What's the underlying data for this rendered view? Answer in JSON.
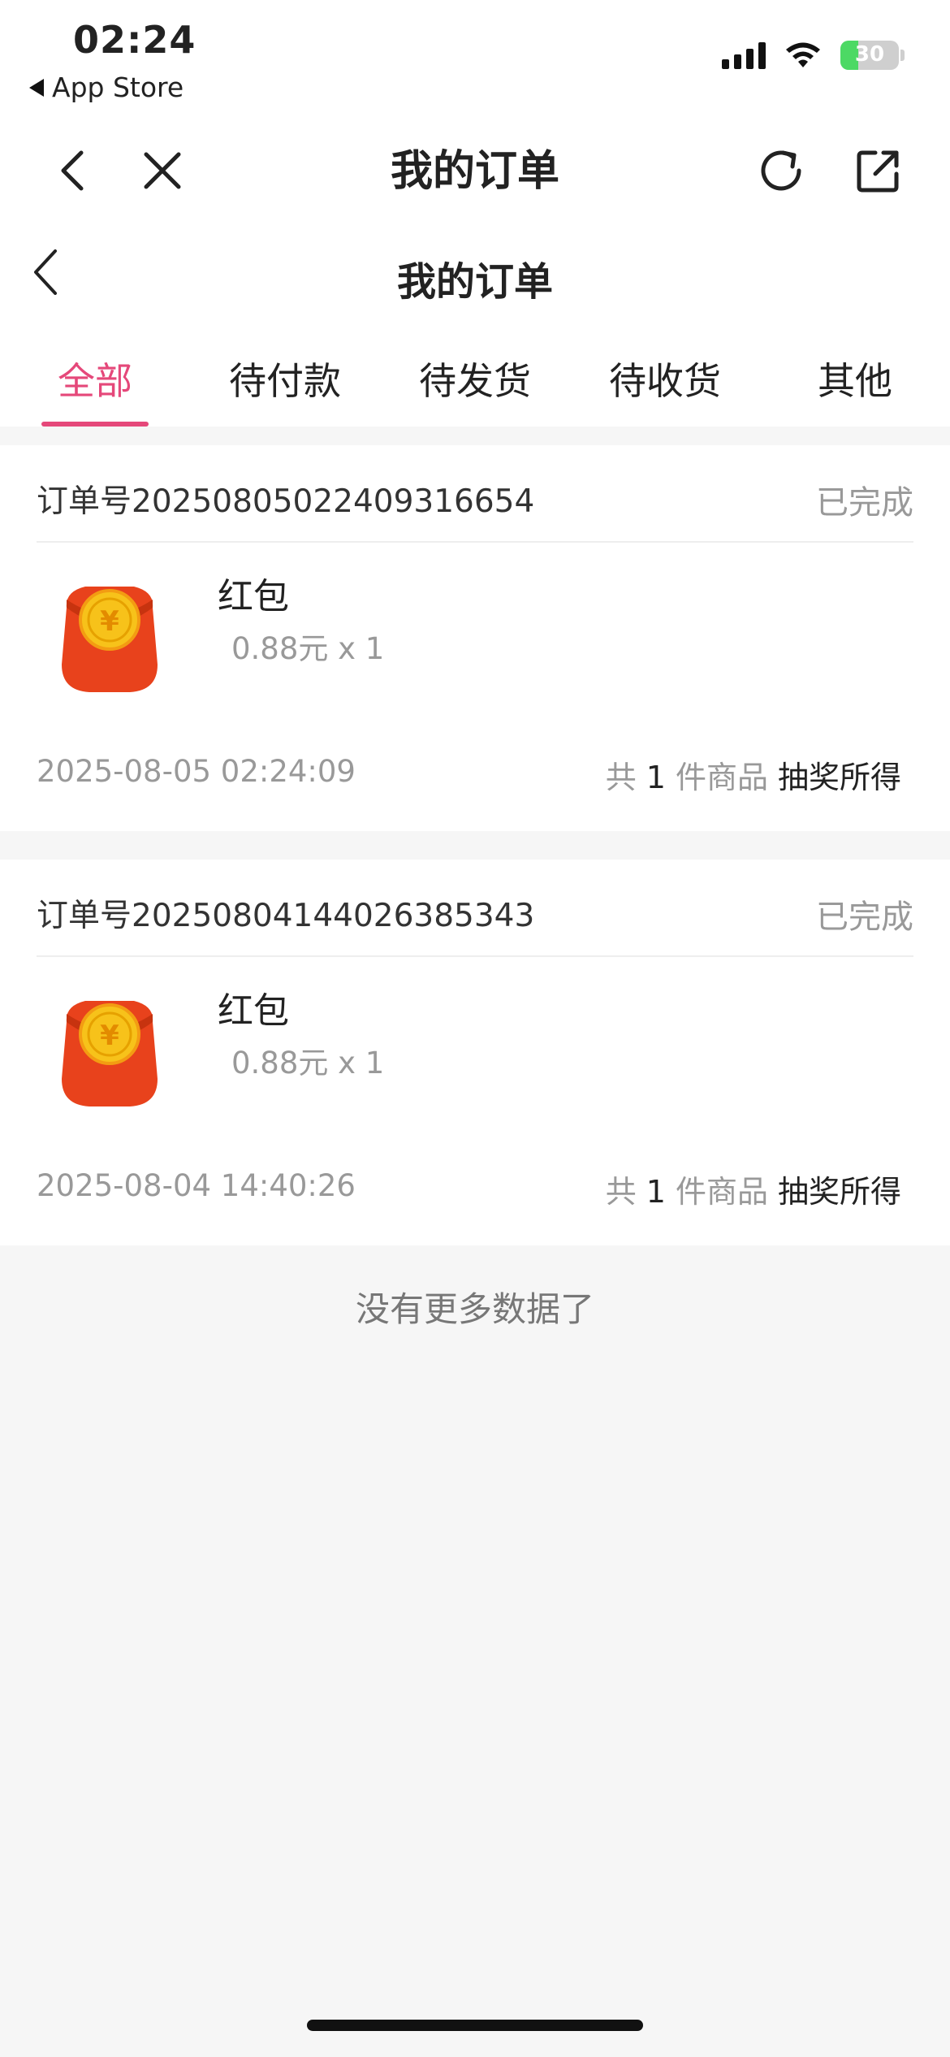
{
  "status_bar": {
    "time": "02:24",
    "back_app": "App Store",
    "battery": "30"
  },
  "navbar": {
    "title": "我的订单"
  },
  "page": {
    "title": "我的订单"
  },
  "tabs": [
    {
      "label": "全部",
      "active": true
    },
    {
      "label": "待付款",
      "active": false
    },
    {
      "label": "待发货",
      "active": false
    },
    {
      "label": "待收货",
      "active": false
    },
    {
      "label": "其他",
      "active": false
    }
  ],
  "orders": [
    {
      "order_no": "订单号20250805022409316654",
      "status": "已完成",
      "item_name": "红包",
      "item_price": "0.88元 x 1",
      "date": "2025-08-05 02:24:09",
      "count_prefix": "共",
      "count": "1",
      "count_suffix": "件商品",
      "source": "抽奖所得"
    },
    {
      "order_no": "订单号20250804144026385343",
      "status": "已完成",
      "item_name": "红包",
      "item_price": "0.88元 x 1",
      "date": "2025-08-04 14:40:26",
      "count_prefix": "共",
      "count": "1",
      "count_suffix": "件商品",
      "source": "抽奖所得"
    }
  ],
  "footer": {
    "no_more": "没有更多数据了"
  },
  "colors": {
    "accent": "#e5487a",
    "battery": "#4cd964",
    "redpack": "#e8421c",
    "coin": "#f7c21a"
  }
}
